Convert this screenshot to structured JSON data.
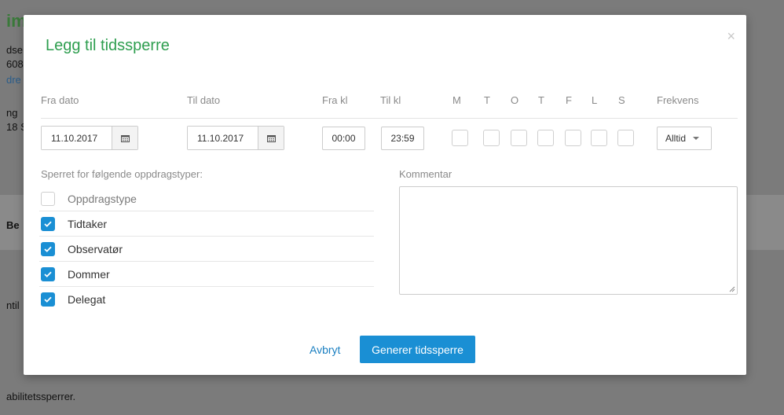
{
  "background": {
    "heading_fragment": "im",
    "lines": [
      "dse",
      "608",
      "ng",
      "18 S"
    ],
    "link_fragment": "dre",
    "section_fragment": "Be",
    "side_fragment": "ntil",
    "footer_fragment": "abilitetssperrer."
  },
  "modal": {
    "title": "Legg til tidssperre",
    "close_glyph": "×",
    "columns": {
      "from_date": "Fra dato",
      "to_date": "Til dato",
      "from_time": "Fra kl",
      "to_time": "Til kl",
      "days": [
        "M",
        "T",
        "O",
        "T",
        "F",
        "L",
        "S"
      ],
      "frequency": "Frekvens"
    },
    "values": {
      "from_date": "11.10.2017",
      "to_date": "11.10.2017",
      "from_time": "00:00",
      "to_time": "23:59",
      "frequency": "Alltid"
    },
    "assignment_types_label": "Sperret for følgende oppdragstyper:",
    "assignment_header": "Oppdragstype",
    "assignment_types": [
      {
        "label": "Tidtaker",
        "checked": true
      },
      {
        "label": "Observatør",
        "checked": true
      },
      {
        "label": "Dommer",
        "checked": true
      },
      {
        "label": "Delegat",
        "checked": true
      }
    ],
    "comment_label": "Kommentar",
    "comment_value": "",
    "cancel_label": "Avbryt",
    "submit_label": "Generer tidssperre"
  },
  "colors": {
    "title_green": "#2e9e4f",
    "primary_blue": "#1a8fd4",
    "link_blue": "#1a7fc1"
  },
  "icons": {
    "calendar": "calendar-icon",
    "check": "check-icon",
    "close": "close-icon",
    "caret": "caret-down-icon"
  }
}
